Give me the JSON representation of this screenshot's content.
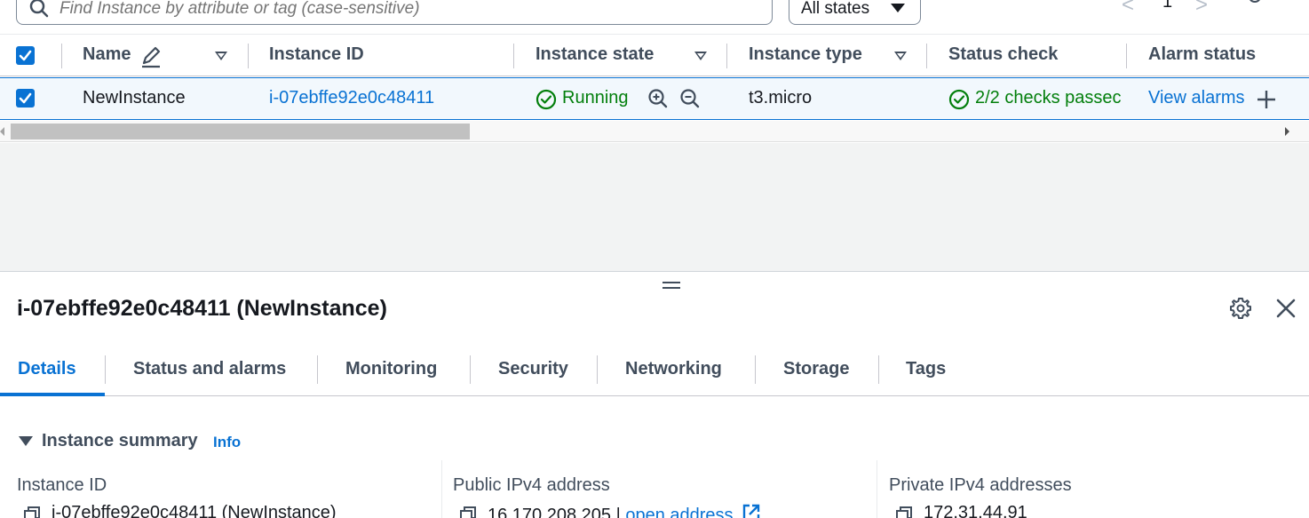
{
  "search": {
    "placeholder": "Find Instance by attribute or tag (case-sensitive)"
  },
  "state_filter": {
    "selected": "All states"
  },
  "pagination": {
    "current_page": "1",
    "prev_glyph": "<",
    "next_glyph": ">"
  },
  "table": {
    "columns": {
      "name": "Name",
      "instance_id": "Instance ID",
      "instance_state": "Instance state",
      "instance_type": "Instance type",
      "status_check": "Status check",
      "alarm_status": "Alarm status"
    },
    "rows": [
      {
        "selected": true,
        "name": "NewInstance",
        "instance_id": "i-07ebffe92e0c48411",
        "instance_state": "Running",
        "instance_type": "t3.micro",
        "status_check": "2/2 checks passec",
        "alarm_status": "View alarms"
      }
    ],
    "header_checkbox_checked": true
  },
  "details": {
    "title": "i-07ebffe92e0c48411 (NewInstance)",
    "tabs": [
      {
        "label": "Details",
        "active": true
      },
      {
        "label": "Status and alarms",
        "active": false
      },
      {
        "label": "Monitoring",
        "active": false
      },
      {
        "label": "Security",
        "active": false
      },
      {
        "label": "Networking",
        "active": false
      },
      {
        "label": "Storage",
        "active": false
      },
      {
        "label": "Tags",
        "active": false
      }
    ],
    "section": {
      "title": "Instance summary",
      "info_label": "Info"
    },
    "fields": [
      {
        "label": "Instance ID",
        "value": "i-07ebffe92e0c48411 (NewInstance)"
      },
      {
        "label": "Public IPv4 address",
        "value": "16.170.208.205 |",
        "link": "open address"
      },
      {
        "label": "Private IPv4 addresses",
        "value": "172.31.44.91"
      }
    ]
  },
  "colors": {
    "link": "#0972d3",
    "success": "#037f0c",
    "selected_row_bg": "#f2f8fd",
    "header_text": "#414d5c"
  }
}
